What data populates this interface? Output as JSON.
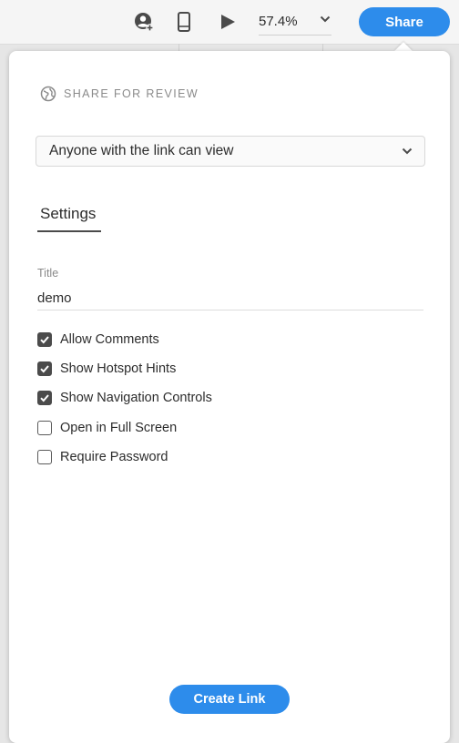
{
  "toolbar": {
    "icons": [
      "user-plus-icon",
      "mobile-device-icon",
      "play-icon",
      "chevron-down-icon"
    ],
    "zoom_value": "57.4%",
    "share_label": "Share",
    "accent_color": "#2d8ceb"
  },
  "share_panel": {
    "section_icon": "globe-icon",
    "section_title": "SHARE FOR REVIEW",
    "access_option": "Anyone with the link can view",
    "tab_label": "Settings",
    "title_label": "Title",
    "title_value": "demo",
    "options": [
      {
        "label": "Allow Comments",
        "checked": true
      },
      {
        "label": "Show Hotspot Hints",
        "checked": true
      },
      {
        "label": "Show Navigation Controls",
        "checked": true
      },
      {
        "label": "Open in Full Screen",
        "checked": false
      },
      {
        "label": "Require Password",
        "checked": false
      }
    ],
    "create_link_label": "Create Link"
  }
}
